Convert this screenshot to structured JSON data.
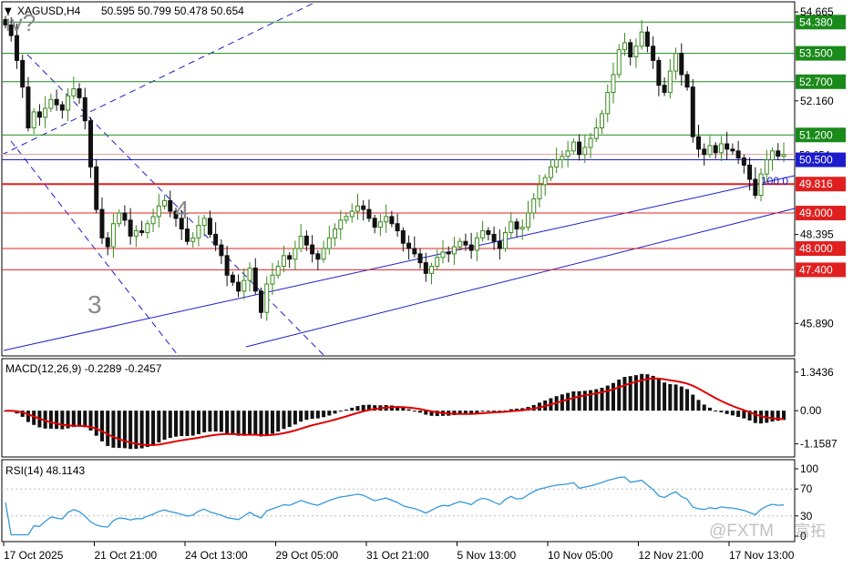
{
  "header": {
    "symbol": "XAGUSD,H4",
    "ohlc": "50.595 50.799 50.478 50.654",
    "corner_glyph": "▼"
  },
  "wave_labels": {
    "iv": "iv?",
    "four": "4",
    "three": "3"
  },
  "fib_label": "100.0",
  "watermark": {
    "brand": "@FXTM",
    "cn": "富拓"
  },
  "colors": {
    "bull": "#3a8a1e",
    "bear": "#111111",
    "green_line": "#1a8a1a",
    "red_line": "#e02020",
    "blue_line": "#1c1ccc",
    "macd_signal": "#e00000",
    "rsi": "#3399dd",
    "axis": "#000000"
  },
  "chart_data": [
    {
      "type": "candlestick",
      "symbol": "XAGUSD",
      "timeframe": "H4",
      "ylim": [
        45.0,
        54.9
      ],
      "y_ticks": [
        {
          "value": 54.665,
          "label": "54.665"
        },
        {
          "value": 52.16,
          "label": "52.160"
        },
        {
          "value": 48.395,
          "label": "48.395"
        },
        {
          "value": 45.89,
          "label": "45.890"
        }
      ],
      "price_levels": [
        {
          "value": 54.38,
          "label": "54.380",
          "color": "green"
        },
        {
          "value": 53.5,
          "label": "53.500",
          "color": "green"
        },
        {
          "value": 52.7,
          "label": "52.700",
          "color": "green"
        },
        {
          "value": 51.2,
          "label": "51.200",
          "color": "green"
        },
        {
          "value": 50.654,
          "label": "50.654",
          "color": "current"
        },
        {
          "value": 50.5,
          "label": "50.500",
          "color": "blue"
        },
        {
          "value": 49.816,
          "label": "49.816",
          "color": "red"
        },
        {
          "value": 49.0,
          "label": "49.000",
          "color": "red"
        },
        {
          "value": 48.0,
          "label": "48.000",
          "color": "red"
        },
        {
          "value": 47.4,
          "label": "47.400",
          "color": "red"
        }
      ],
      "x_labels": [
        "17 Oct 2025",
        "21 Oct 21:00",
        "24 Oct 13:00",
        "29 Oct 05:00",
        "31 Oct 21:00",
        "5 Nov 13:00",
        "10 Nov 05:00",
        "12 Nov 21:00",
        "17 Nov 13:00"
      ],
      "closes": [
        54.3,
        54.0,
        53.3,
        52.55,
        51.4,
        51.85,
        51.7,
        51.95,
        52.2,
        52.05,
        51.9,
        52.3,
        52.5,
        52.25,
        51.6,
        50.3,
        49.1,
        48.3,
        48.05,
        48.7,
        49.0,
        48.8,
        48.35,
        48.5,
        48.45,
        48.7,
        48.9,
        49.2,
        49.35,
        49.05,
        48.85,
        48.55,
        48.2,
        48.3,
        48.65,
        48.85,
        48.4,
        48.1,
        47.8,
        47.25,
        47.05,
        46.8,
        47.1,
        47.45,
        46.8,
        46.2,
        47.0,
        47.25,
        47.5,
        47.8,
        47.7,
        48.0,
        48.35,
        48.1,
        47.85,
        47.7,
        48.0,
        48.3,
        48.55,
        48.8,
        48.9,
        49.05,
        49.2,
        49.1,
        48.85,
        48.6,
        48.75,
        48.9,
        48.7,
        48.5,
        48.15,
        48.0,
        47.85,
        47.6,
        47.3,
        47.5,
        47.75,
        47.9,
        47.85,
        48.05,
        48.2,
        48.1,
        47.95,
        48.3,
        48.5,
        48.4,
        48.2,
        48.0,
        48.45,
        48.75,
        48.55,
        48.6,
        49.0,
        49.4,
        49.8,
        50.0,
        50.3,
        50.5,
        50.6,
        50.75,
        51.0,
        50.65,
        50.85,
        51.1,
        51.4,
        51.8,
        52.4,
        52.9,
        53.6,
        53.8,
        53.4,
        53.7,
        54.1,
        53.7,
        53.3,
        52.6,
        52.4,
        53.0,
        53.5,
        52.9,
        52.55,
        51.15,
        50.8,
        50.65,
        50.9,
        50.7,
        50.95,
        50.8,
        50.75,
        50.55,
        50.35,
        49.95,
        49.5,
        50.1,
        50.5,
        50.75,
        50.6,
        50.65
      ],
      "series_colors": {
        "up": "#3a8a1e",
        "down": "#111111"
      }
    },
    {
      "type": "bar",
      "title": "MACD(12,26,9) -0.2289 -0.2457",
      "indicator": "MACD(12,26,9)",
      "values": [
        -0.2289,
        -0.2457
      ],
      "y_ticks": [
        {
          "value": 1.3436,
          "label": "1.3436"
        },
        {
          "value": 0.0,
          "label": "0.00"
        },
        {
          "value": -1.1587,
          "label": "-1.1587"
        }
      ],
      "ylim": [
        -1.55,
        1.75
      ]
    },
    {
      "type": "line",
      "title": "RSI(14) 48.1143",
      "indicator": "RSI(14)",
      "value": 48.1143,
      "y_ticks": [
        {
          "value": 100,
          "label": "100"
        },
        {
          "value": 70,
          "label": "70"
        },
        {
          "value": 30,
          "label": "30"
        },
        {
          "value": 0,
          "label": "0"
        }
      ],
      "ylim": [
        0,
        100
      ]
    }
  ]
}
